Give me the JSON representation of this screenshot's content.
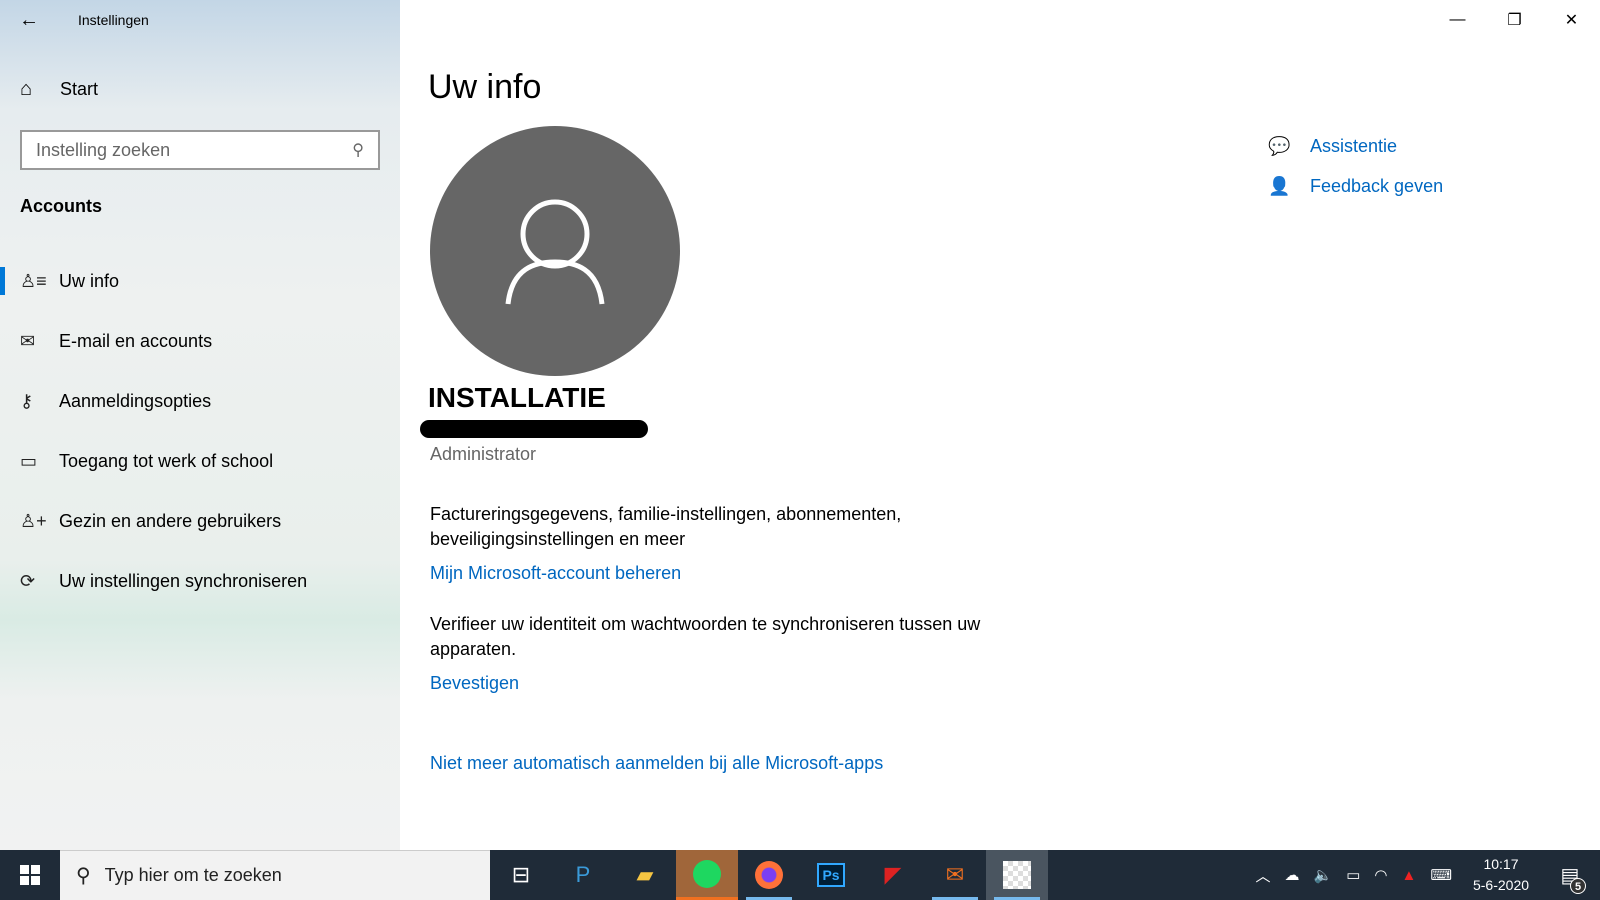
{
  "window": {
    "title": "Instellingen"
  },
  "sidebar": {
    "home": "Start",
    "search_placeholder": "Instelling zoeken",
    "section": "Accounts",
    "items": [
      {
        "label": "Uw info",
        "icon": "person-list-icon"
      },
      {
        "label": "E-mail en accounts",
        "icon": "mail-icon"
      },
      {
        "label": "Aanmeldingsopties",
        "icon": "key-icon"
      },
      {
        "label": "Toegang tot werk of school",
        "icon": "briefcase-icon"
      },
      {
        "label": "Gezin en andere gebruikers",
        "icon": "person-add-icon"
      },
      {
        "label": "Uw instellingen synchroniseren",
        "icon": "sync-icon"
      }
    ]
  },
  "main": {
    "heading": "Uw info",
    "username": "INSTALLATIE",
    "role": "Administrator",
    "desc1": "Factureringsgegevens, familie-instellingen, abonnementen, beveiligingsinstellingen en meer",
    "link1": "Mijn Microsoft-account beheren",
    "desc2": "Verifieer uw identiteit om wachtwoorden te synchroniseren tussen uw apparaten.",
    "link2": "Bevestigen",
    "link3": "Niet meer automatisch aanmelden bij alle Microsoft-apps"
  },
  "help": {
    "assist": "Assistentie",
    "feedback": "Feedback geven"
  },
  "taskbar": {
    "search_placeholder": "Typ hier om te zoeken",
    "time": "10:17",
    "date": "5-6-2020",
    "notifications": "5"
  },
  "colors": {
    "accent": "#0078d7",
    "link": "#0067c0",
    "taskbar": "#1f2b38"
  }
}
